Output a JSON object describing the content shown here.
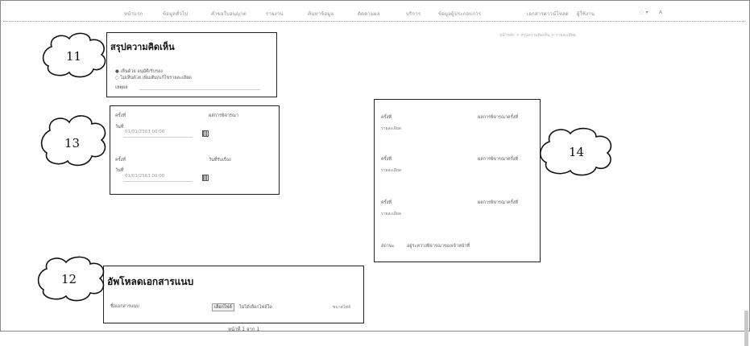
{
  "nav": {
    "items": [
      "หน้าแรก",
      "ข้อมูลทั่วไป",
      "คำขอใบอนุญาต",
      "รายงาน",
      "ค้นหาข้อมูล",
      "ติดตามผล",
      "บริการ",
      "ข้อมูลผู้ประกอบการ",
      "เอกสารดาวน์โหลด",
      "ผู้ใช้งาน"
    ],
    "user_glyph": "A"
  },
  "breadcrumb": "หน้าหลัก > สรุปความคิดเห็น > รายละเอียด",
  "callouts": {
    "c11": "11",
    "c12": "12",
    "c13": "13",
    "c14": "14"
  },
  "summary": {
    "title": "สรุปความคิดเห็น",
    "line1": "● เห็นด้วย อนุมัติ/รับรอง",
    "line2": "○ ไม่เห็นด้วย เพิ่มเติม/แก้ไขรายละเอียด",
    "line3": "เหตุผล"
  },
  "dates": {
    "row1_label": "ครั้งที่",
    "row1_right": "ผลการพิจารณา",
    "row1_date_label": "วันที่",
    "row1_date_value": "01/01/2563 00:00",
    "row2_label": "ครั้งที่",
    "row2_right": "วันที่รับเรื่อง",
    "row2_date_label": "วันที่",
    "row2_date_value": "01/01/2563 00:00"
  },
  "rounds": {
    "items": [
      {
        "label": "ครั้งที่",
        "right": "ผลการพิจารณาครั้งที่",
        "value": "รายละเอียด"
      },
      {
        "label": "ครั้งที่",
        "right": "ผลการพิจารณาครั้งที่",
        "value": "รายละเอียด"
      },
      {
        "label": "ครั้งที่",
        "right": "ผลการพิจารณาครั้งที่",
        "value": "รายละเอียด"
      }
    ],
    "footer_label": "สถานะ",
    "footer_value": "อยู่ระหว่างพิจารณาของเจ้าหน้าที่"
  },
  "upload": {
    "title": "อัพโหลดเอกสารแนบ",
    "field_label": "ชื่อเอกสารแนบ",
    "choose_button": "เลือกไฟล์",
    "no_file_text": "ไม่ได้เลือกไฟล์ใด",
    "right_text": "ขนาดไฟล์"
  },
  "bottom_note": "หน้าที่ 1 จาก 1"
}
